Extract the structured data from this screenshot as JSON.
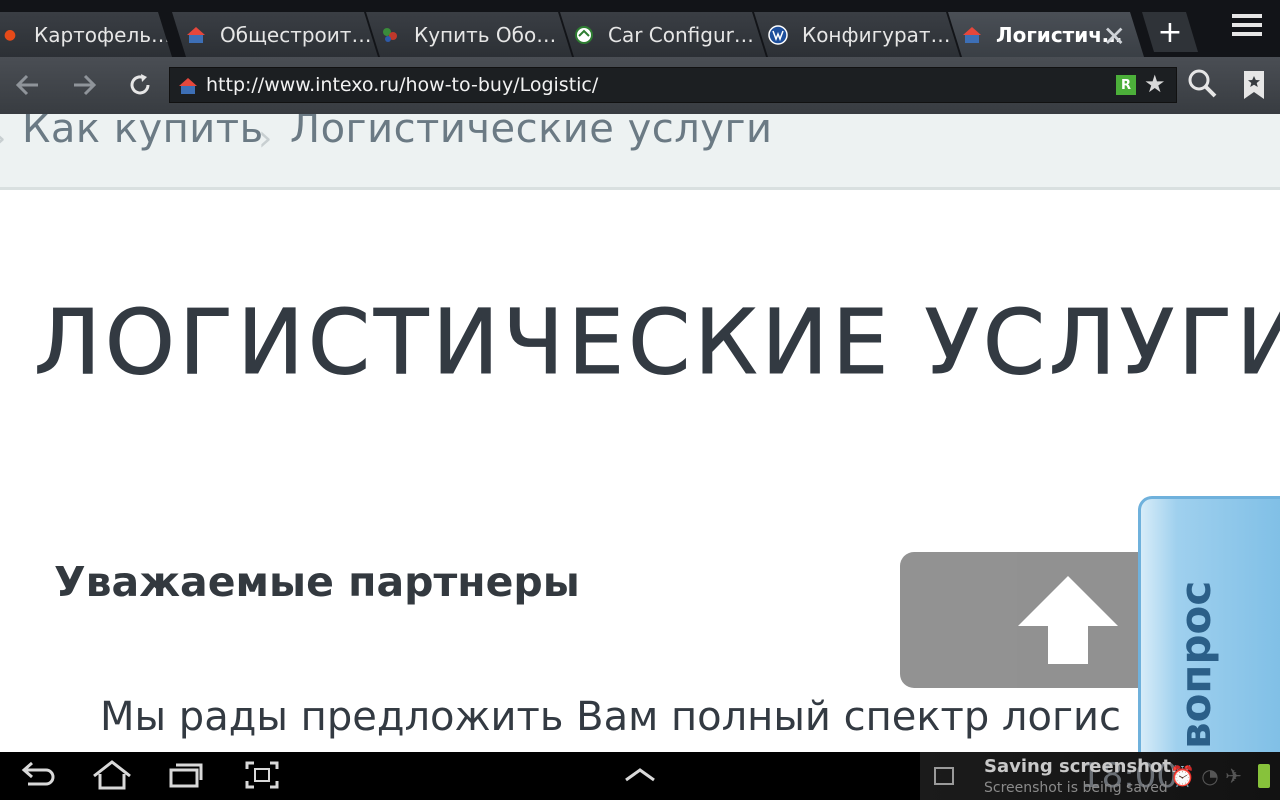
{
  "browser": {
    "tabs": [
      {
        "title": "Картофель…",
        "icon": "red-food-favicon"
      },
      {
        "title": "Общестроит…",
        "icon": "intexo-favicon"
      },
      {
        "title": "Купить Обо…",
        "icon": "leaves-favicon"
      },
      {
        "title": "Car Configur…",
        "icon": "skoda-favicon"
      },
      {
        "title": "Конфигурат…",
        "icon": "vw-favicon"
      },
      {
        "title": "Логистич…",
        "icon": "intexo-favicon",
        "active": true
      }
    ],
    "close_symbol": "✕",
    "new_tab_symbol": "+",
    "url": "http://www.intexo.ru/how-to-buy/Logistic/",
    "rss_badge": "R"
  },
  "page": {
    "breadcrumb": [
      "Как купить",
      "Логистические услуги"
    ],
    "title": "ЛОГИСТИЧЕСКИЕ УСЛУГИ",
    "heading": "Уважаемые партнеры",
    "body_text": "Мы рады предложить Вам полный спектр логис",
    "question_tab": "вопрос"
  },
  "system": {
    "notification_title": "Saving screenshot…",
    "notification_sub": "Screenshot is being saved",
    "clock": "18:00"
  },
  "colors": {
    "breadcrumb_bg": "#edf2f2",
    "title": "#333a42",
    "question_tab": "#8cc6ea",
    "battery": "#87c23b"
  }
}
